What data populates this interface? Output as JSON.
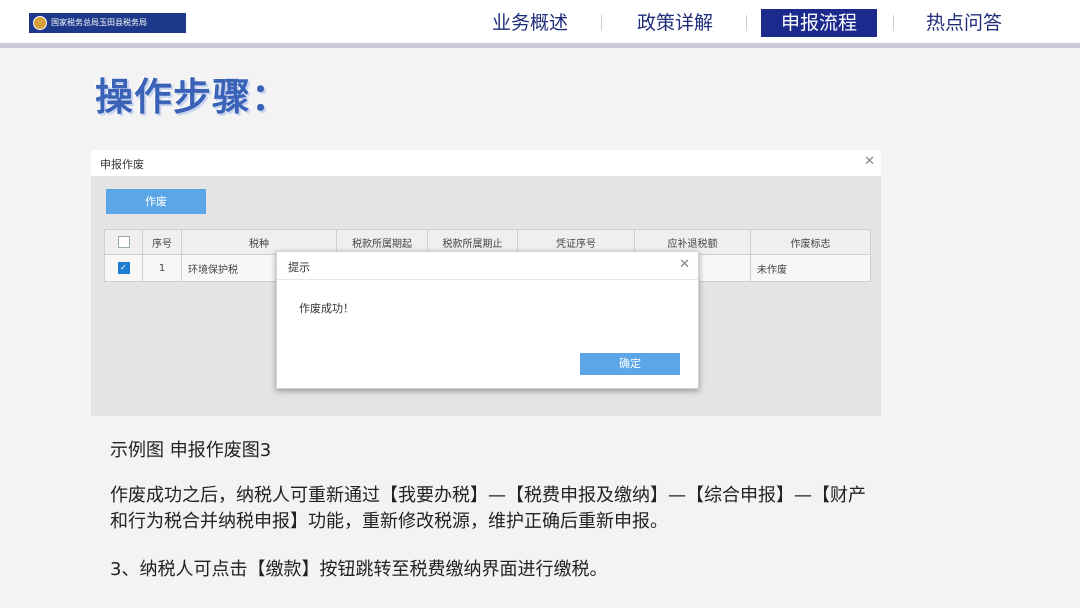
{
  "header": {
    "logo_text": "国家税务总局玉田县税务局",
    "nav": [
      {
        "label": "业务概述"
      },
      {
        "label": "政策详解"
      },
      {
        "label": "申报流程"
      },
      {
        "label": "热点问答"
      }
    ],
    "active_index": 2
  },
  "heading": "操作步骤：",
  "window": {
    "title": "申报作废",
    "void_button": "作废",
    "columns": [
      "",
      "序号",
      "税种",
      "税款所属期起",
      "税款所属期止",
      "凭证序号",
      "应补退税额",
      "作废标志"
    ],
    "rows": [
      {
        "checked": true,
        "index": "1",
        "tax_type": "环境保护税",
        "period_start": "",
        "period_end": "",
        "voucher": "",
        "amount": "",
        "status": "未作废"
      }
    ]
  },
  "dialog": {
    "title": "提示",
    "message": "作废成功！",
    "ok_button": "确定"
  },
  "caption": "示例图  申报作废图3",
  "paragraphs": [
    "作废成功之后，纳税人可重新通过【我要办税】—【税费申报及缴纳】—【综合申报】—【财产和行为税合并纳税申报】功能，重新修改税源，维护正确后重新申报。",
    "3、纳税人可点击【缴款】按钮跳转至税费缴纳界面进行缴税。"
  ],
  "colors": {
    "nav_active": "#1b2a8c",
    "nav_text": "#1f2d7a",
    "heading": "#3a63b8",
    "button": "#5aa6e6"
  }
}
